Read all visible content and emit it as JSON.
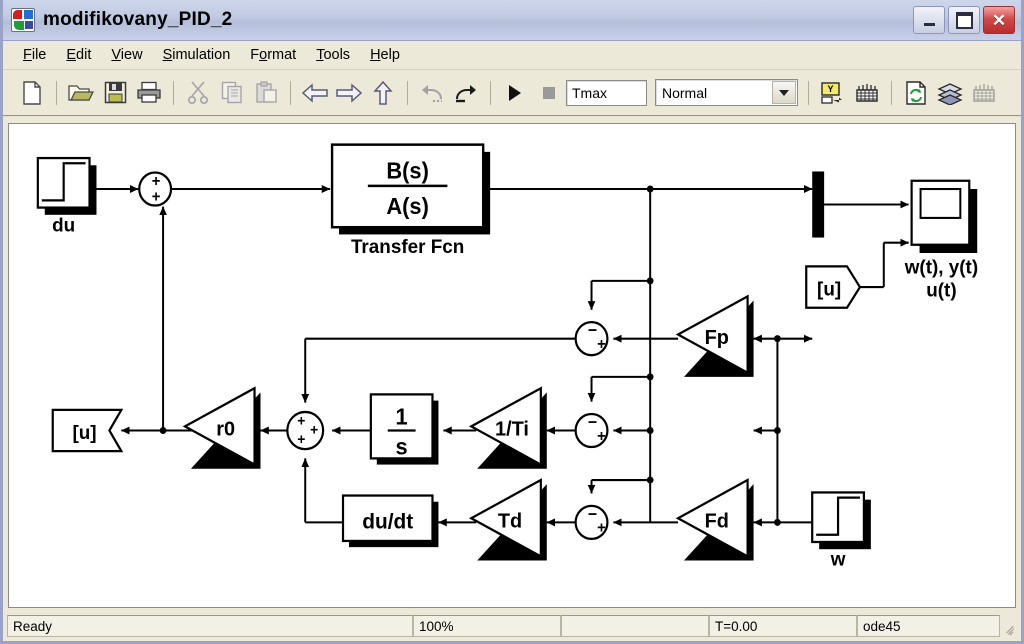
{
  "window": {
    "title": "modifikovany_PID_2",
    "icon": "simulink-model-icon",
    "controls": [
      {
        "name": "minimize-button",
        "label": "_"
      },
      {
        "name": "maximize-button",
        "label": "□"
      },
      {
        "name": "close-button",
        "label": "✕"
      }
    ]
  },
  "menubar": {
    "items": [
      {
        "label": "File",
        "mnemonic": "F"
      },
      {
        "label": "Edit",
        "mnemonic": "E"
      },
      {
        "label": "View",
        "mnemonic": "V"
      },
      {
        "label": "Simulation",
        "mnemonic": "S"
      },
      {
        "label": "Format",
        "mnemonic": "o"
      },
      {
        "label": "Tools",
        "mnemonic": "T"
      },
      {
        "label": "Help",
        "mnemonic": "H"
      }
    ]
  },
  "toolbar": {
    "buttons": [
      {
        "name": "new-model-button",
        "icon": "new-document-icon",
        "enabled": true
      },
      {
        "name": "open-model-button",
        "icon": "open-folder-icon",
        "enabled": true
      },
      {
        "name": "save-model-button",
        "icon": "floppy-disk-icon",
        "enabled": true
      },
      {
        "name": "print-button",
        "icon": "printer-icon",
        "enabled": true
      },
      {
        "name": "cut-button",
        "icon": "scissors-icon",
        "enabled": false
      },
      {
        "name": "copy-button",
        "icon": "copy-icon",
        "enabled": false
      },
      {
        "name": "paste-button",
        "icon": "clipboard-icon",
        "enabled": false
      },
      {
        "name": "back-button",
        "icon": "arrow-left-icon",
        "enabled": true
      },
      {
        "name": "forward-button",
        "icon": "arrow-right-icon",
        "enabled": true
      },
      {
        "name": "up-to-parent-button",
        "icon": "arrow-up-icon",
        "enabled": true
      },
      {
        "name": "undo-button",
        "icon": "undo-icon",
        "enabled": false
      },
      {
        "name": "redo-button",
        "icon": "redo-icon",
        "enabled": true
      },
      {
        "name": "start-simulation-button",
        "icon": "play-icon",
        "enabled": true
      },
      {
        "name": "stop-simulation-button",
        "icon": "stop-square-icon",
        "enabled": false
      },
      {
        "name": "build-button",
        "icon": "build-icon",
        "enabled": true
      },
      {
        "name": "debug-button",
        "icon": "debugger-icon",
        "enabled": true
      },
      {
        "name": "update-diagram-button",
        "icon": "update-diagram-icon",
        "enabled": true
      },
      {
        "name": "model-browser-button",
        "icon": "layers-icon",
        "enabled": true
      },
      {
        "name": "library-browser-button",
        "icon": "library-icon",
        "enabled": false
      }
    ],
    "stop_time_value": "Tmax",
    "sim_mode_value": "Normal"
  },
  "statusbar": {
    "status": "Ready",
    "zoom": "100%",
    "blank": "",
    "time": "T=0.00",
    "solver": "ode45"
  },
  "diagram": {
    "blocks": {
      "step_du": "du",
      "sum_input": "+\n+",
      "transfer_fcn_num": "B(s)",
      "transfer_fcn_den": "A(s)",
      "transfer_fcn_label": "Transfer Fcn",
      "mux": "mux",
      "from_u": "[u]",
      "scope_label_line1": "w(t), y(t)",
      "scope_label_line2": "u(t)",
      "gain_fp": "Fp",
      "gain_fd": "Fd",
      "gain_ti": "1/Ti",
      "gain_td": "Td",
      "gain_r0": "r0",
      "integrator_num": "1",
      "integrator_den": "s",
      "derivative": "du/dt",
      "goto_u": "[u]",
      "step_w": "w",
      "sum_sign_minus": "−",
      "sum_sign_plus": "+"
    }
  }
}
